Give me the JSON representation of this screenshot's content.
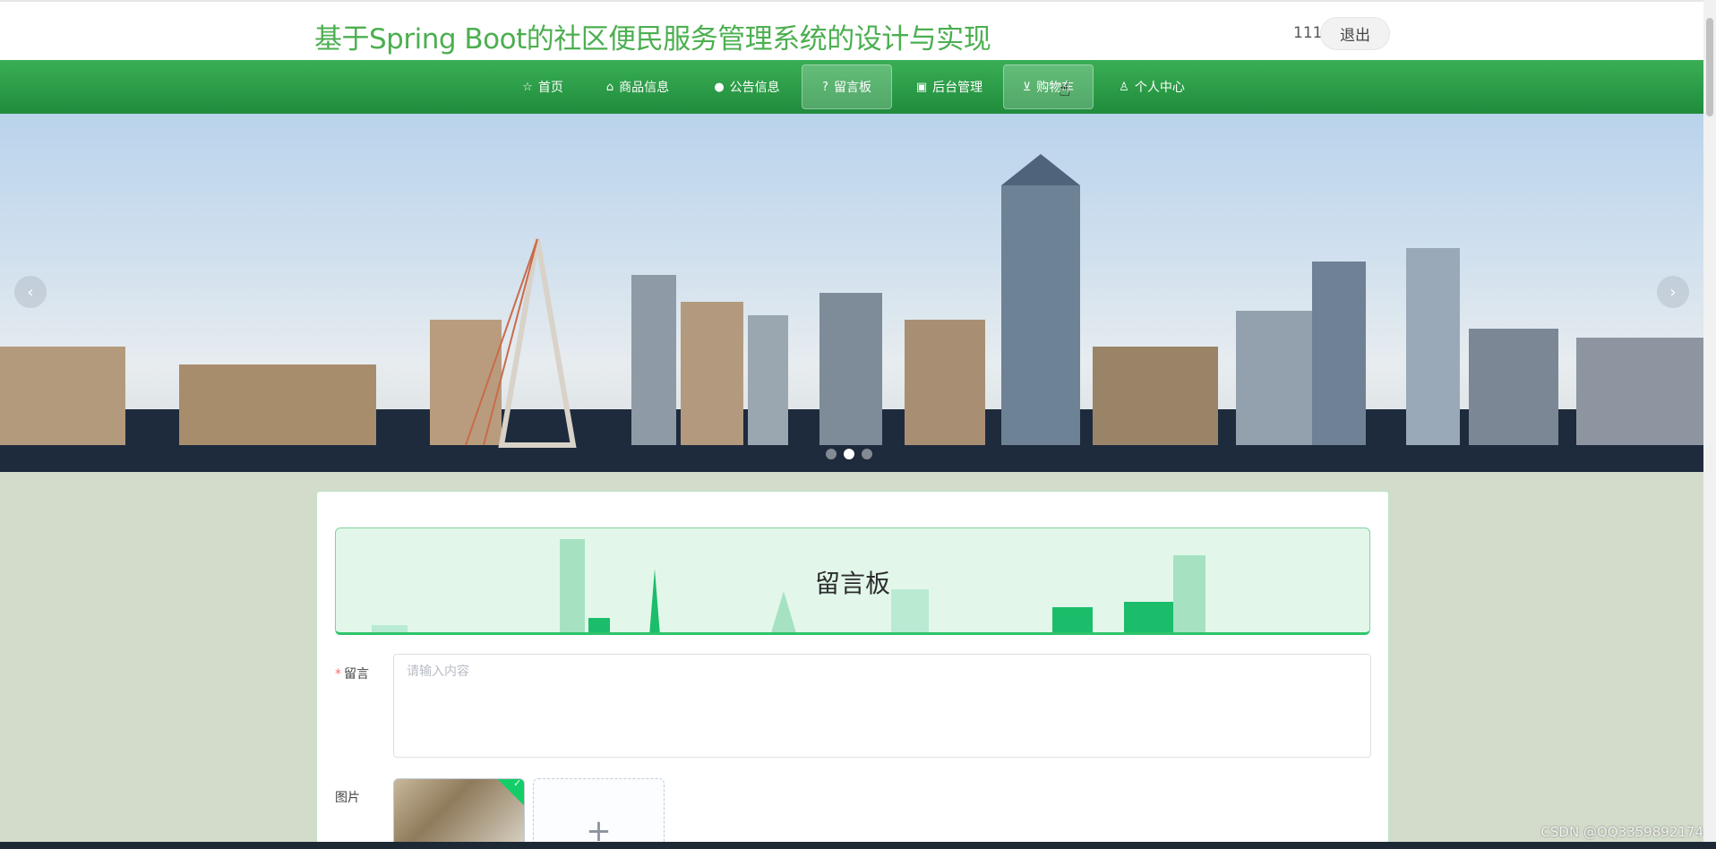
{
  "header": {
    "site_title": "基于Spring Boot的社区便民服务管理系统的设计与实现",
    "user_name": "111",
    "logout_label": "退出"
  },
  "nav": {
    "items": [
      {
        "label": "首页",
        "icon": "star-icon"
      },
      {
        "label": "商品信息",
        "icon": "bag-icon"
      },
      {
        "label": "公告信息",
        "icon": "info-icon"
      },
      {
        "label": "留言板",
        "icon": "question-icon",
        "active": true
      },
      {
        "label": "后台管理",
        "icon": "box-icon"
      },
      {
        "label": "购物车",
        "icon": "cart-icon",
        "hover": true
      },
      {
        "label": "个人中心",
        "icon": "user-icon"
      }
    ]
  },
  "carousel": {
    "prev_icon": "‹",
    "next_icon": "›",
    "slide_count": 3,
    "active_index": 1
  },
  "board": {
    "title": "留言板",
    "message_label": "留言",
    "message_placeholder": "请输入内容",
    "image_label": "图片",
    "upload_add_icon": "+"
  },
  "watermark": "CSDN @QQ3359892174",
  "colors": {
    "brand_green": "#4caf50",
    "nav_green": "#1f8c3c",
    "board_bg": "#e2f7ea",
    "page_bg": "#d3dccb"
  }
}
